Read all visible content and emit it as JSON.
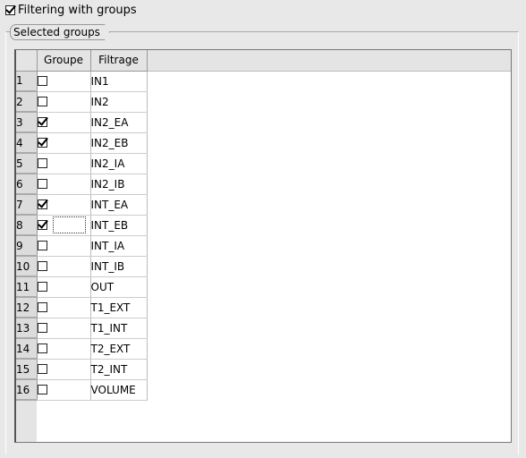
{
  "header": {
    "filter_checkbox_label": "Filtering with groups",
    "filter_checked": true
  },
  "panel": {
    "tab_label": "Selected groups"
  },
  "table": {
    "columns": [
      "Groupe",
      "Filtrage"
    ],
    "rows": [
      {
        "num": "1",
        "checked": false,
        "name": "IN1"
      },
      {
        "num": "2",
        "checked": false,
        "name": "IN2"
      },
      {
        "num": "3",
        "checked": true,
        "name": "IN2_EA"
      },
      {
        "num": "4",
        "checked": true,
        "name": "IN2_EB"
      },
      {
        "num": "5",
        "checked": false,
        "name": "IN2_IA"
      },
      {
        "num": "6",
        "checked": false,
        "name": "IN2_IB"
      },
      {
        "num": "7",
        "checked": true,
        "name": "INT_EA"
      },
      {
        "num": "8",
        "checked": true,
        "name": "INT_EB",
        "focused": true
      },
      {
        "num": "9",
        "checked": false,
        "name": "INT_IA"
      },
      {
        "num": "10",
        "checked": false,
        "name": "INT_IB"
      },
      {
        "num": "11",
        "checked": false,
        "name": "OUT"
      },
      {
        "num": "12",
        "checked": false,
        "name": "T1_EXT"
      },
      {
        "num": "13",
        "checked": false,
        "name": "T1_INT"
      },
      {
        "num": "14",
        "checked": false,
        "name": "T2_EXT"
      },
      {
        "num": "15",
        "checked": false,
        "name": "T2_INT"
      },
      {
        "num": "16",
        "checked": false,
        "name": "VOLUME"
      }
    ]
  }
}
